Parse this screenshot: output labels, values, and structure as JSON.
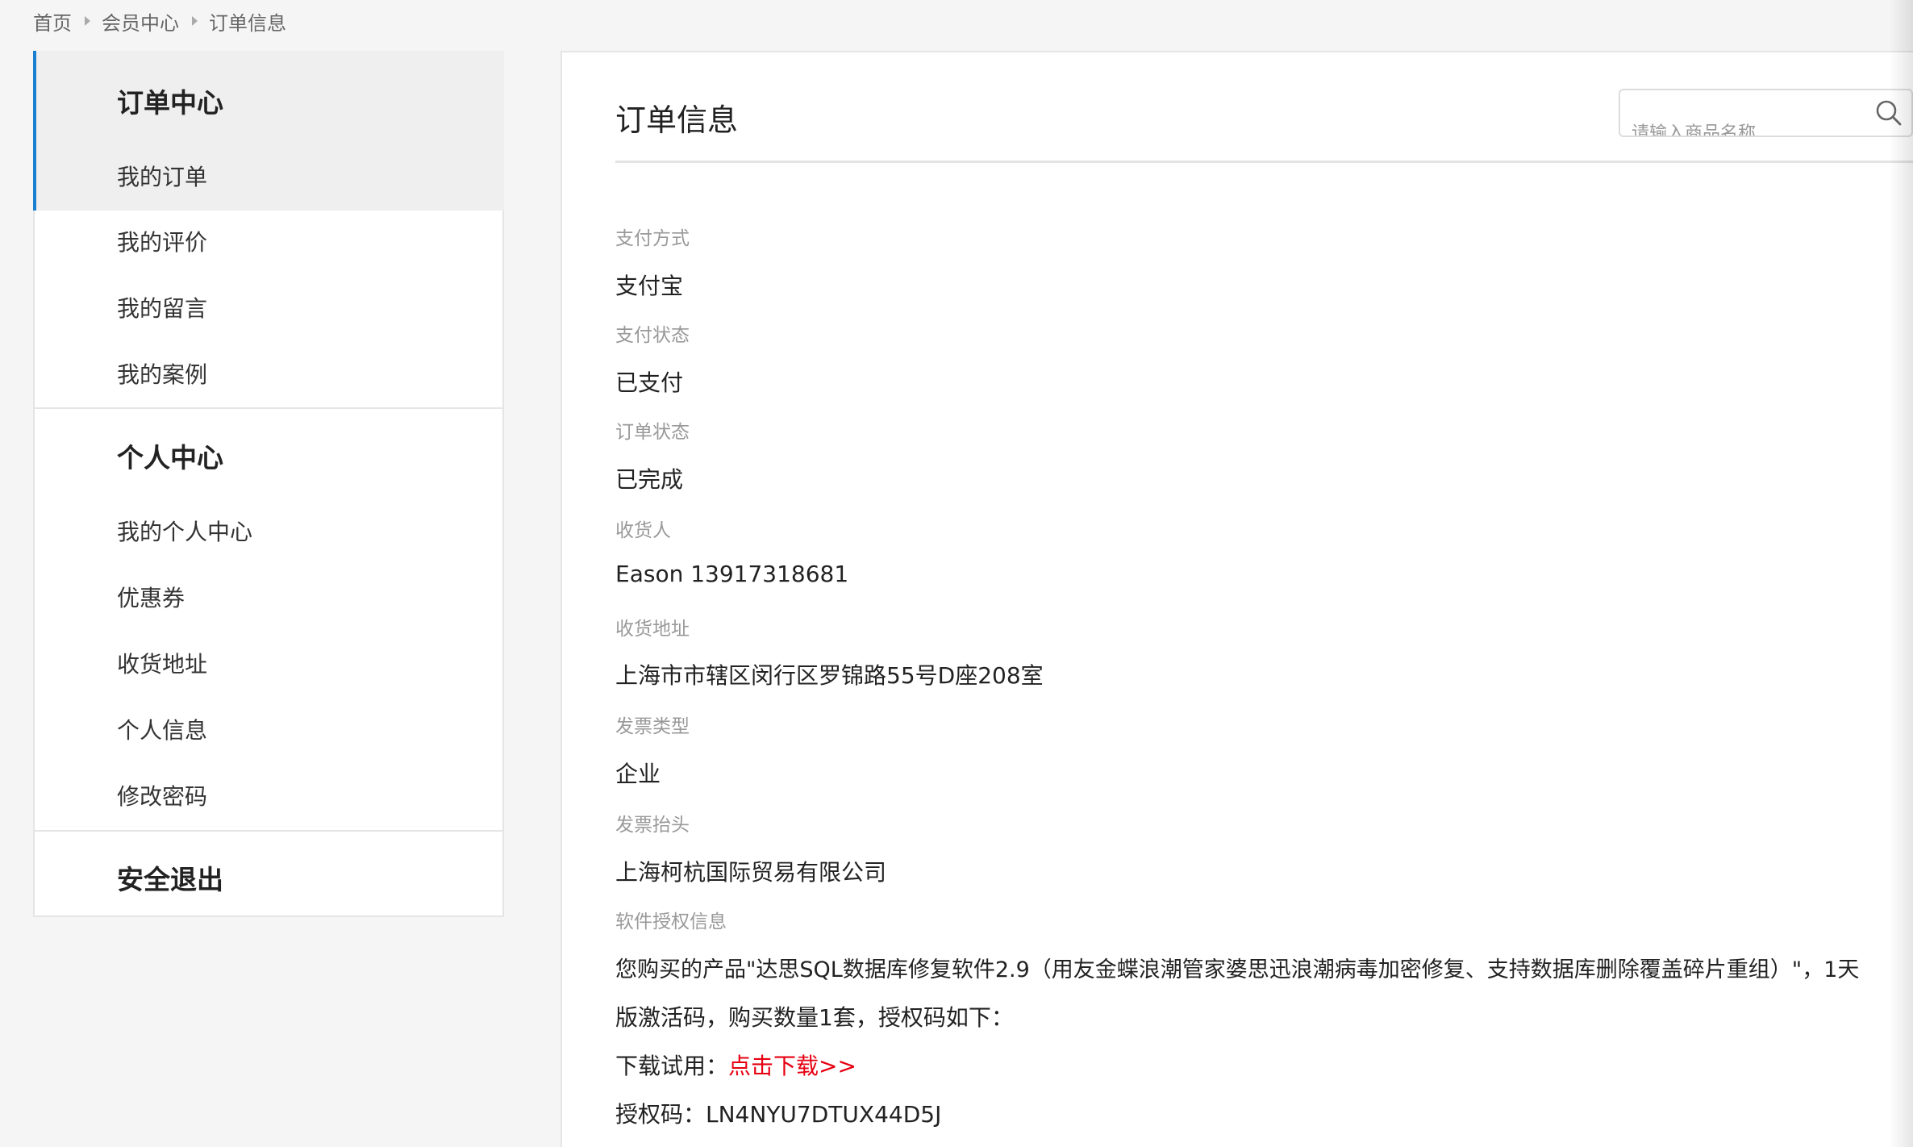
{
  "breadcrumb": {
    "items": [
      "首页",
      "会员中心",
      "订单信息"
    ]
  },
  "sidebar": {
    "groups": [
      {
        "title": "订单中心",
        "items": [
          "我的订单",
          "我的评价",
          "我的留言",
          "我的案例"
        ]
      },
      {
        "title": "个人中心",
        "items": [
          "我的个人中心",
          "优惠券",
          "收货地址",
          "个人信息",
          "修改密码"
        ]
      },
      {
        "title": "安全退出",
        "items": []
      }
    ],
    "active_item": "我的订单",
    "accent_color": "#1a7fd1"
  },
  "main": {
    "title": "订单信息",
    "search": {
      "placeholder": "请输入商品名称",
      "icon": "search-icon"
    },
    "fields": [
      {
        "label": "支付方式",
        "value": "支付宝"
      },
      {
        "label": "支付状态",
        "value": "已支付"
      },
      {
        "label": "订单状态",
        "value": "已完成"
      },
      {
        "label": "收货人",
        "value": "Eason 13917318681"
      },
      {
        "label": "收货地址",
        "value": "上海市市辖区闵行区罗锦路55号D座208室"
      },
      {
        "label": "发票类型",
        "value": "企业"
      },
      {
        "label": "发票抬头",
        "value": "上海柯杭国际贸易有限公司"
      }
    ],
    "license": {
      "label": "软件授权信息",
      "line1": "您购买的产品\"达思SQL数据库修复软件2.9（用友金蝶浪潮管家婆思迅浪潮病毒加密修复、支持数据库删除覆盖碎片重组）\"，1天",
      "line2": "版激活码，购买数量1套，授权码如下：",
      "download_prefix": "下载试用：",
      "download_link": "点击下载>>",
      "code_prefix": "授权码：",
      "code": "LN4NYU7DTUX44D5J",
      "link_color": "#e60012"
    }
  }
}
